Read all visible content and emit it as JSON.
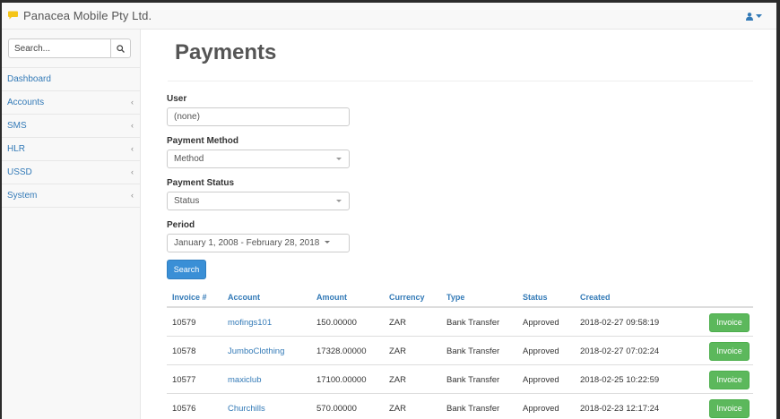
{
  "app": {
    "title": "Panacea Mobile Pty Ltd."
  },
  "colors": {
    "accent": "#337ab7",
    "logo": "#f5c518",
    "success": "#5cb85c",
    "primary": "#3a8fd6"
  },
  "navbar": {
    "user_icon": "user-icon",
    "dropdown_icon": "caret-down-icon"
  },
  "sidebar": {
    "search": {
      "placeholder": "Search...",
      "icon": "search-icon"
    },
    "items": [
      {
        "label": "Dashboard",
        "arrow": ""
      },
      {
        "label": "Accounts",
        "arrow": "‹"
      },
      {
        "label": "SMS",
        "arrow": "‹"
      },
      {
        "label": "HLR",
        "arrow": "‹"
      },
      {
        "label": "USSD",
        "arrow": "‹"
      },
      {
        "label": "System",
        "arrow": "‹"
      }
    ]
  },
  "main": {
    "title": "Payments",
    "filters": {
      "user": {
        "label": "User",
        "value": "(none)"
      },
      "method": {
        "label": "Payment Method",
        "value": "Method"
      },
      "status": {
        "label": "Payment Status",
        "value": "Status"
      },
      "period": {
        "label": "Period",
        "value": "January 1, 2008 - February 28, 2018"
      }
    },
    "search_button": "Search",
    "table": {
      "headers": [
        "Invoice #",
        "Account",
        "Amount",
        "Currency",
        "Type",
        "Status",
        "Created"
      ],
      "rows": [
        {
          "invoice": "10579",
          "account": "mofings101",
          "amount": "150.00000",
          "currency": "ZAR",
          "type": "Bank Transfer",
          "status": "Approved",
          "created": "2018-02-27 09:58:19",
          "action": "Invoice"
        },
        {
          "invoice": "10578",
          "account": "JumboClothing",
          "amount": "17328.00000",
          "currency": "ZAR",
          "type": "Bank Transfer",
          "status": "Approved",
          "created": "2018-02-27 07:02:24",
          "action": "Invoice"
        },
        {
          "invoice": "10577",
          "account": "maxiclub",
          "amount": "17100.00000",
          "currency": "ZAR",
          "type": "Bank Transfer",
          "status": "Approved",
          "created": "2018-02-25 10:22:59",
          "action": "Invoice"
        },
        {
          "invoice": "10576",
          "account": "Churchills",
          "amount": "570.00000",
          "currency": "ZAR",
          "type": "Bank Transfer",
          "status": "Approved",
          "created": "2018-02-23 12:17:24",
          "action": "Invoice"
        }
      ]
    }
  }
}
